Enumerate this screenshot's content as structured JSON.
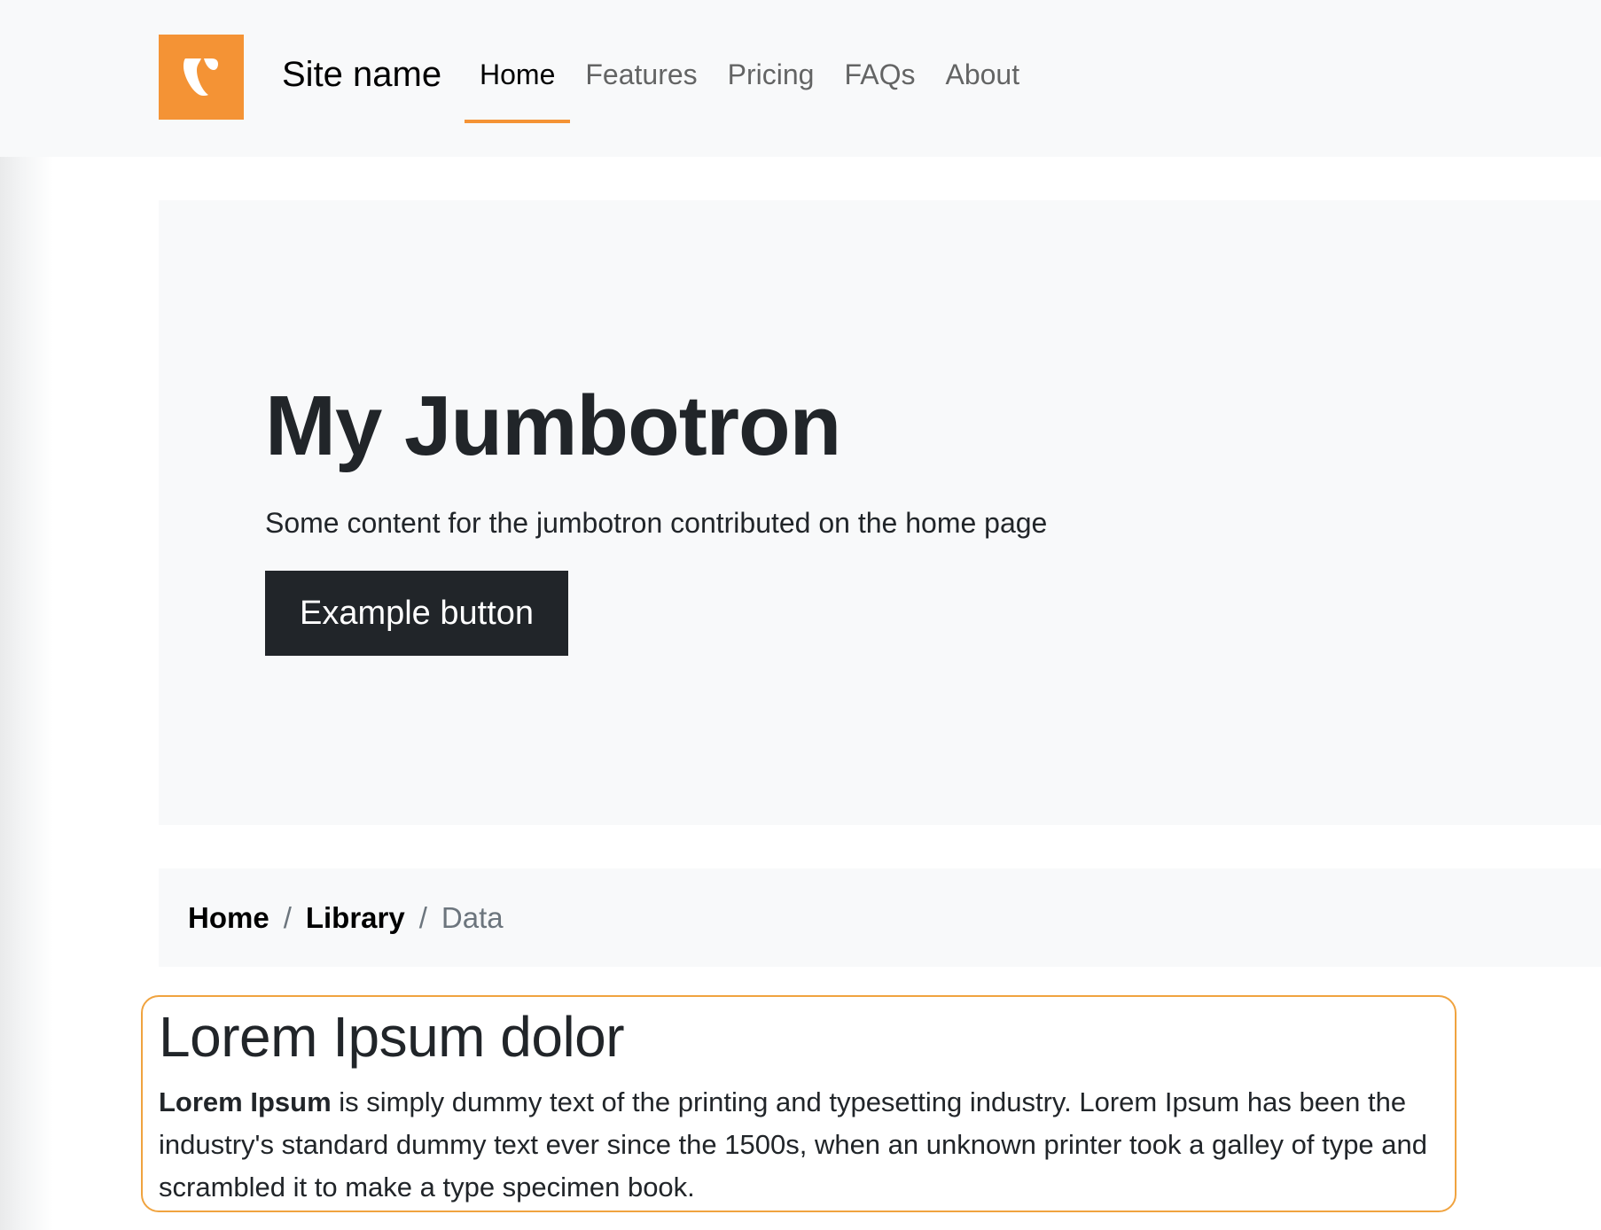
{
  "header": {
    "logo_icon": "typo3-logo-icon",
    "site_name": "Site name",
    "nav": [
      {
        "label": "Home",
        "active": true
      },
      {
        "label": "Features",
        "active": false
      },
      {
        "label": "Pricing",
        "active": false
      },
      {
        "label": "FAQs",
        "active": false
      },
      {
        "label": "About",
        "active": false
      }
    ]
  },
  "jumbotron": {
    "title": "My Jumbotron",
    "text": "Some content for the jumbotron contributed on the home page",
    "button_label": "Example button"
  },
  "breadcrumb": {
    "items": [
      "Home",
      "Library"
    ],
    "separator": "/",
    "current": "Data"
  },
  "content": {
    "title": "Lorem Ipsum dolor",
    "bold_lead": "Lorem Ipsum",
    "paragraph": " is simply dummy text of the printing and typesetting industry. Lorem Ipsum has been the industry's standard dummy text ever since the 1500s, when an unknown printer took a galley of type and scrambled it to make a type specimen book."
  },
  "colors": {
    "accent": "#f49335",
    "header_bg": "#f8f9fa",
    "dark": "#212529",
    "outline": "#f0a33f"
  }
}
